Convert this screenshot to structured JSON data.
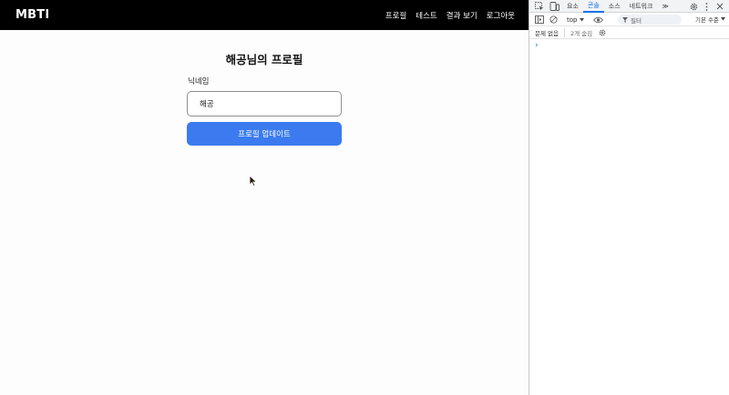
{
  "navbar": {
    "brand": "MBTI",
    "links": [
      "프로필",
      "테스트",
      "결과 보기",
      "로그아웃"
    ]
  },
  "profile": {
    "title": "해공님의 프로필",
    "nickname_label": "닉네임",
    "nickname_value": "해공",
    "update_button": "프로필 업데이트"
  },
  "devtools": {
    "tabs": [
      "요소",
      "콘솔",
      "소스",
      "네트워크"
    ],
    "active_tab": "콘솔",
    "more_tabs": "≫",
    "context": "top",
    "filter_placeholder": "필터",
    "level": "기본 수준",
    "issues": "문제 없음",
    "hidden": "2개 숨김",
    "prompt": "›"
  },
  "colors": {
    "navbar_bg": "#000000",
    "button_bg": "#3b7bef",
    "devtools_accent": "#1a73e8"
  },
  "icons": [
    "inspect-icon",
    "device-toggle-icon",
    "settings-icon",
    "more-vert-icon",
    "close-icon",
    "sidebar-toggle-icon",
    "clear-console-icon",
    "eye-icon",
    "filter-icon",
    "chevron-down-icon",
    "gear-icon",
    "mouse-cursor-icon"
  ]
}
